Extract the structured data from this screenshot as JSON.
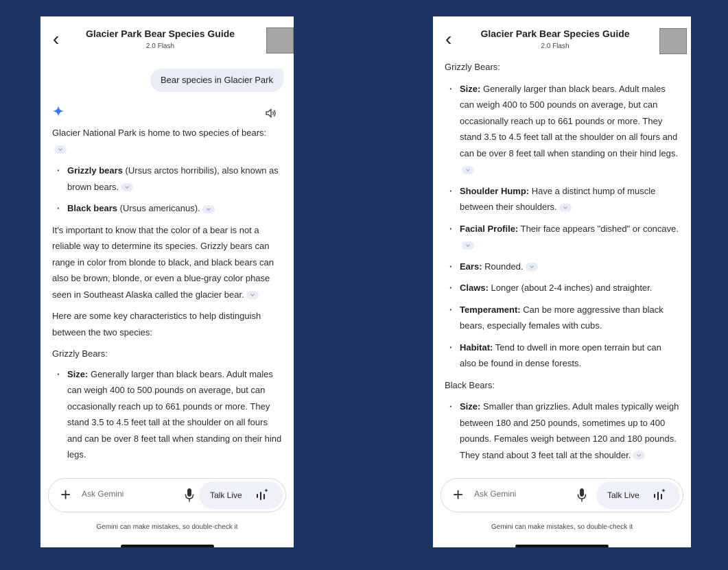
{
  "colors": {
    "background": "#1c3462",
    "accent": "#3b7bf0"
  },
  "header": {
    "title": "Glacier Park Bear Species Guide",
    "model": "2.0 Flash"
  },
  "chat": {
    "user_message": "Bear species in Glacier Park",
    "intro": "Glacier National Park is home to two species of bears:",
    "species": [
      {
        "name": "Grizzly bears",
        "rest": " (Ursus arctos horribilis), also known as brown bears."
      },
      {
        "name": "Black bears",
        "rest": " (Ursus americanus)."
      }
    ],
    "color_note": "It's important to know that the color of a bear is not a reliable way to determine its species. Grizzly bears can range in color from blonde to black, and black bears can also be brown, blonde, or even a blue-gray color phase seen in Southeast Alaska called the glacier bear.",
    "characteristics_intro": "Here are some key characteristics to help distinguish between the two species:",
    "grizzly": {
      "heading": "Grizzly Bears:",
      "items": [
        {
          "label": "Size:",
          "text": " Generally larger than black bears. Adult males can weigh 400 to 500 pounds on average, but can occasionally reach up to 661 pounds or more. They stand 3.5 to 4.5 feet tall at the shoulder on all fours and can be over 8 feet tall when standing on their hind legs."
        },
        {
          "label": "Shoulder Hump:",
          "text": " Have a distinct hump of muscle between their shoulders."
        },
        {
          "label": "Facial Profile:",
          "text": " Their face appears \"dished\" or concave."
        },
        {
          "label": "Ears:",
          "text": " Rounded."
        },
        {
          "label": "Claws:",
          "text": " Longer (about 2-4 inches) and straighter."
        },
        {
          "label": "Temperament:",
          "text": " Can be more aggressive than black bears, especially females with cubs."
        },
        {
          "label": "Habitat:",
          "text": " Tend to dwell in more open terrain but can also be found in dense forests."
        }
      ]
    },
    "black": {
      "heading": "Black Bears:",
      "items": [
        {
          "label": "Size:",
          "text": " Smaller than grizzlies. Adult males typically weigh between 180 and 250 pounds, sometimes up to 400 pounds. Females weigh between 120 and 180 pounds. They stand about 3 feet tall at the shoulder."
        }
      ]
    }
  },
  "input": {
    "placeholder": "Ask Gemini",
    "talk_live": "Talk Live"
  },
  "disclaimer": "Gemini can make mistakes, so double-check it"
}
